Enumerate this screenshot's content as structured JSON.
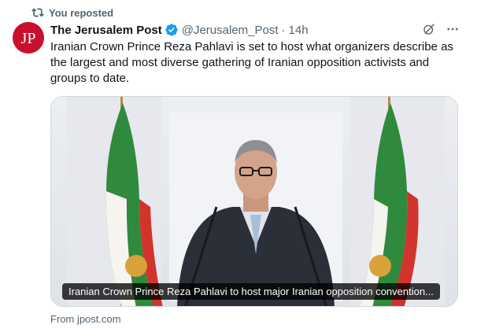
{
  "repost": {
    "label": "You reposted",
    "icon": "repost-icon"
  },
  "author": {
    "avatar_text": "JP",
    "display_name": "The Jerusalem Post",
    "verified": true,
    "handle": "@Jerusalem_Post",
    "separator": "·",
    "time": "14h"
  },
  "tweet": {
    "text": "Iranian Crown Prince Reza Pahlavi is set to host what organizers describe as the largest and most diverse gathering of Iranian opposition activists and groups to date."
  },
  "media": {
    "caption": "Iranian Crown Prince Reza Pahlavi to host major Iranian opposition convention..."
  },
  "source": {
    "label": "From jpost.com"
  },
  "colors": {
    "brand_red": "#c8102e",
    "verified_blue": "#1d9bf0",
    "secondary_text": "#536471"
  }
}
